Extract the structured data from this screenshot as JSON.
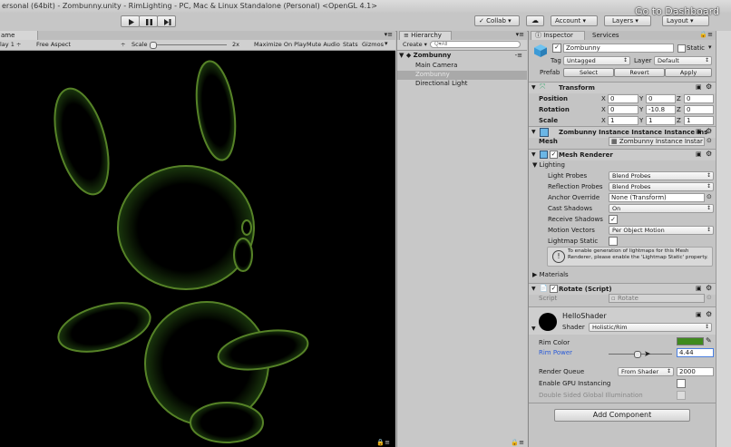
{
  "titlebar": {
    "title": "ersonal (64bit) - Zombunny.unity - RimLighting - PC, Mac & Linux Standalone (Personal) <OpenGL 4.1>",
    "goto": "Go to Dashboard"
  },
  "toolbar": {
    "play_icon": "play-icon",
    "pause_icon": "pause-icon",
    "step_icon": "step-icon",
    "collab": "Collab",
    "account": "Account",
    "layers": "Layers",
    "layout": "Layout"
  },
  "game": {
    "tab": "ame",
    "display": "lay 1",
    "aspect": "Free Aspect",
    "scale_label": "Scale",
    "scale_value": "2x",
    "maximize": "Maximize On Play",
    "mute": "Mute Audio",
    "stats": "Stats",
    "gizmos": "Gizmos"
  },
  "hierarchy": {
    "tab": "Hierarchy",
    "create": "Create",
    "search_placeholder": "Q▾All",
    "scene": "Zombunny",
    "items": [
      "Main Camera",
      "Zombunny",
      "Directional Light"
    ]
  },
  "inspector": {
    "tab": "Inspector",
    "services_tab": "Services",
    "object_name": "Zombunny",
    "static_label": "Static",
    "tag_label": "Tag",
    "tag_value": "Untagged",
    "layer_label": "Layer",
    "layer_value": "Default",
    "prefab_label": "Prefab",
    "prefab_select": "Select",
    "prefab_revert": "Revert",
    "prefab_apply": "Apply",
    "transform": {
      "title": "Transform",
      "rows": [
        {
          "label": "Position",
          "x": "0",
          "y": "0",
          "z": "0"
        },
        {
          "label": "Rotation",
          "x": "0",
          "y": "-10.8",
          "z": "0"
        },
        {
          "label": "Scale",
          "x": "1",
          "y": "1",
          "z": "1"
        }
      ]
    },
    "meshfilter": {
      "title": "Zombunny Instance Instance Instance Ins",
      "mesh_label": "Mesh",
      "mesh_value": "Zombunny Instance Instar"
    },
    "renderer": {
      "title": "Mesh Renderer",
      "lighting": "Lighting",
      "rows": [
        {
          "label": "Light Probes",
          "value": "Blend Probes"
        },
        {
          "label": "Reflection Probes",
          "value": "Blend Probes"
        },
        {
          "label": "Anchor Override",
          "value": "None (Transform)"
        },
        {
          "label": "Cast Shadows",
          "value": "On"
        },
        {
          "label": "Receive Shadows",
          "value": "✓"
        },
        {
          "label": "Motion Vectors",
          "value": "Per Object Motion"
        },
        {
          "label": "Lightmap Static",
          "value": ""
        }
      ],
      "info": "To enable generation of lightmaps for this Mesh Renderer, please enable the 'Lightmap Static' property.",
      "materials": "Materials"
    },
    "rotate": {
      "title": "Rotate (Script)",
      "script_label": "Script",
      "script_value": "Rotate"
    },
    "material": {
      "name": "HelloShader",
      "shader_label": "Shader",
      "shader_value": "Holistic/Rim",
      "rim_color_label": "Rim Color",
      "rim_color": "#3f8a1e",
      "rim_power_label": "Rim Power",
      "rim_power_value": "4.44",
      "rim_power_fraction": 0.44,
      "render_queue_label": "Render Queue",
      "render_queue_mode": "From Shader",
      "render_queue_value": "2000",
      "gpu_instancing": "Enable GPU Instancing",
      "double_sided": "Double Sided Global Illumination"
    },
    "add_component": "Add Component"
  }
}
